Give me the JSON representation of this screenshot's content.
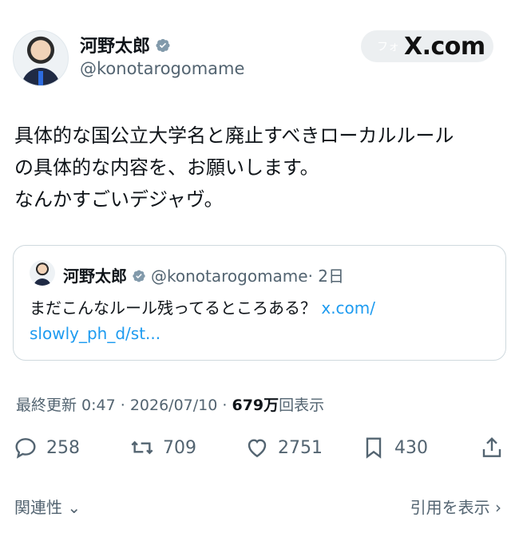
{
  "author": {
    "name": "河野太郎",
    "handle": "@konotarogomame"
  },
  "follow_overlay": {
    "follow_text": "フォ",
    "watermark": "X.com"
  },
  "tweet": {
    "text": "具体的な国公立大学名と廃止すべきローカルルール\nの具体的な内容を、お願いします。\nなんかすごいデジャヴ。"
  },
  "quote": {
    "name": "河野太郎",
    "handle": "@konotarogomame",
    "age": "· 2日",
    "body": "まだこんなルール残ってるところある？",
    "link_line1": "x.com/",
    "link_line2": "slowly_ph_d/st..."
  },
  "meta": {
    "updated": "最終更新 0:47 · 2026/07/10 ·",
    "views_count": "679万",
    "views_label": "回表示"
  },
  "actions": {
    "replies": "258",
    "reposts": "709",
    "likes": "2751",
    "bookmarks": "430"
  },
  "footer": {
    "related": "関連性",
    "view_quotes": "引用を表示"
  },
  "colors": {
    "verified_badge": "#829aab",
    "link": "#1d9bf0",
    "muted": "#536471"
  }
}
